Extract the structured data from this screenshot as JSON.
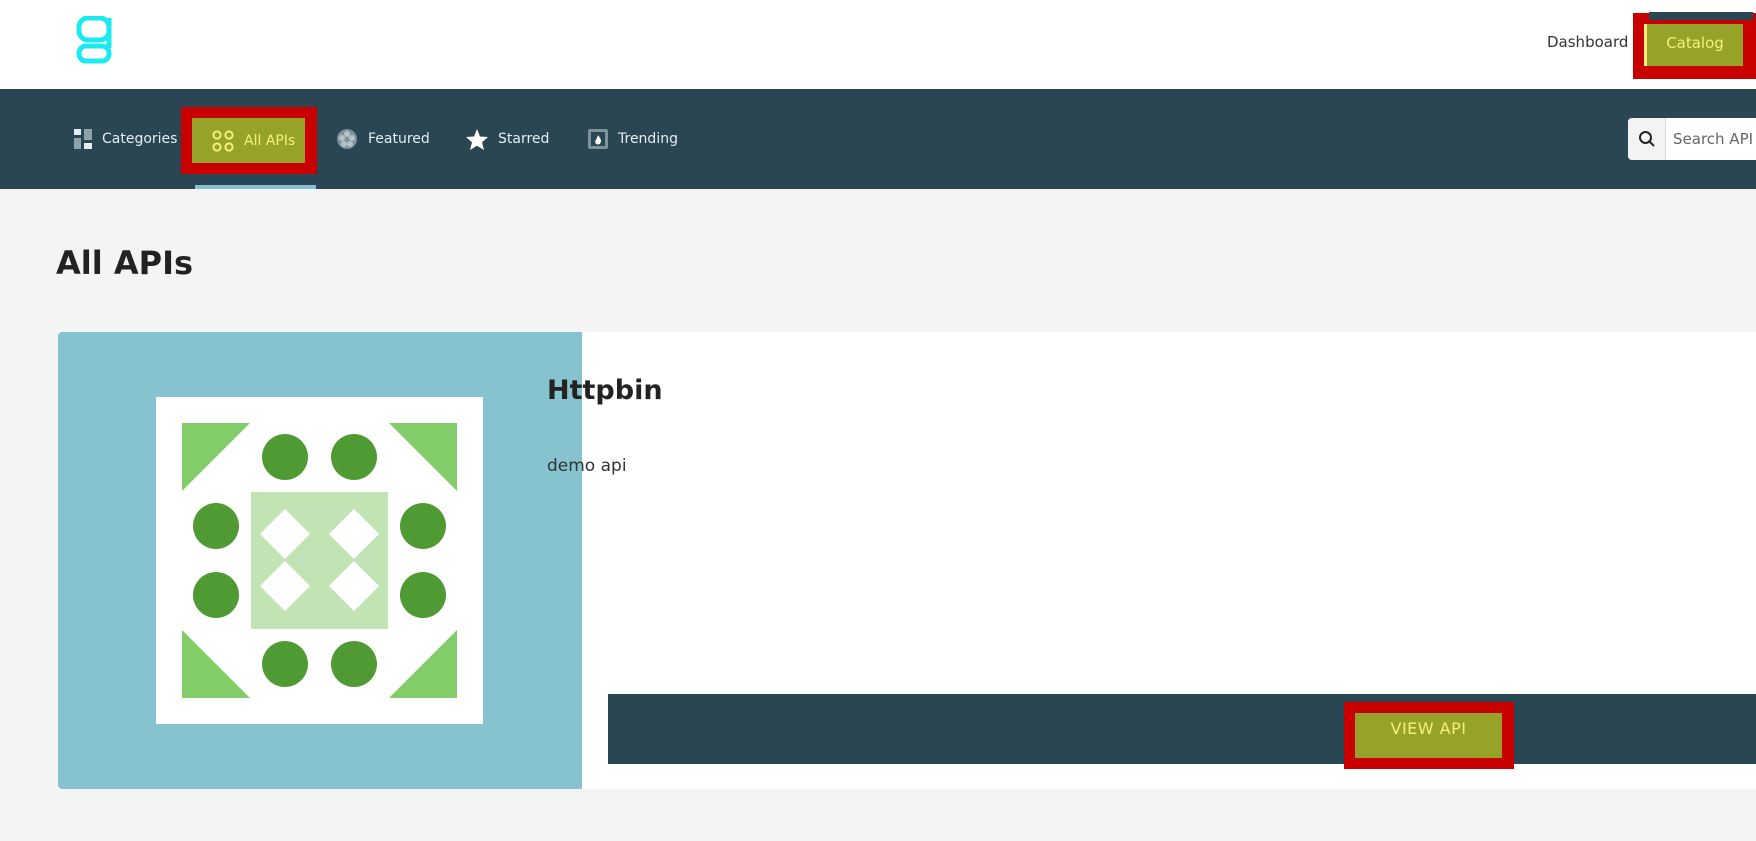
{
  "header": {
    "logo_icon": "g-logo-icon",
    "nav_links": {
      "dashboard": "Dashboard",
      "catalog": "Catalog"
    },
    "accent_color": "#97a229",
    "highlight_color": "#c80000",
    "logo_color": "#1de9f0"
  },
  "subnav": {
    "items": {
      "categories": {
        "label": "Categories",
        "icon": "categories-icon"
      },
      "all_apis": {
        "label": "All APIs",
        "icon": "all-apis-icon",
        "active": true
      },
      "featured": {
        "label": "Featured",
        "icon": "featured-icon"
      },
      "starred": {
        "label": "Starred",
        "icon": "star-icon"
      },
      "trending": {
        "label": "Trending",
        "icon": "trending-icon"
      }
    },
    "search": {
      "placeholder": "Search API",
      "value": ""
    },
    "background_color": "#2a4652"
  },
  "main": {
    "page_title": "All APIs",
    "cards": [
      {
        "title": "Httpbin",
        "description": "demo api",
        "action_label": "VIEW API",
        "image": "identicon-image",
        "image_background": "#87c2cf"
      }
    ]
  }
}
